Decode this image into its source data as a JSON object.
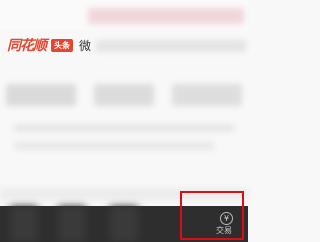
{
  "header": {
    "logo_text": "同花顺",
    "badge": "头条",
    "channel_text": "微"
  },
  "tabbar": {
    "trade": {
      "icon_glyph": "¥",
      "label": "交易"
    }
  },
  "colors": {
    "brand_red": "#e8452f",
    "tabbar_bg": "#2e2e2e",
    "highlight_box": "#d90e17"
  }
}
